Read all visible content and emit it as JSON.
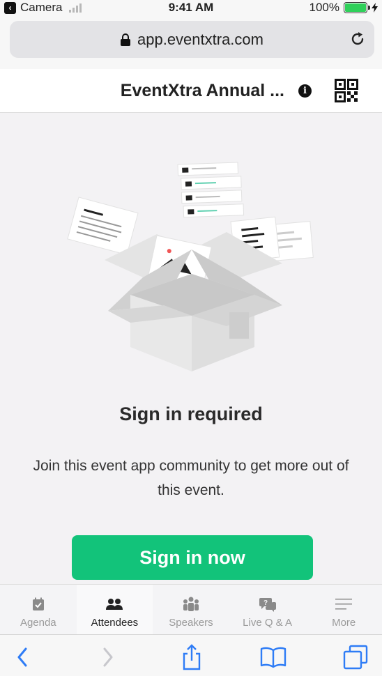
{
  "status_bar": {
    "back_app": "Camera",
    "time": "9:41 AM",
    "battery": "100%"
  },
  "browser": {
    "url": "app.eventxtra.com"
  },
  "header": {
    "title": "EventXtra Annual ...",
    "info_icon": "i"
  },
  "main": {
    "title": "Sign in required",
    "description": "Join this event app community to get more out of this event.",
    "signin_label": "Sign in now"
  },
  "tabs": [
    {
      "label": "Agenda",
      "icon": "calendar-check-icon",
      "active": false
    },
    {
      "label": "Attendees",
      "icon": "people-icon",
      "active": true
    },
    {
      "label": "Speakers",
      "icon": "speakers-icon",
      "active": false
    },
    {
      "label": "Live Q & A",
      "icon": "chat-question-icon",
      "active": false
    },
    {
      "label": "More",
      "icon": "menu-lines-icon",
      "active": false
    }
  ],
  "colors": {
    "accent": "#12c37a",
    "battery": "#2fd05a",
    "ios_blue": "#2e7cf6"
  }
}
